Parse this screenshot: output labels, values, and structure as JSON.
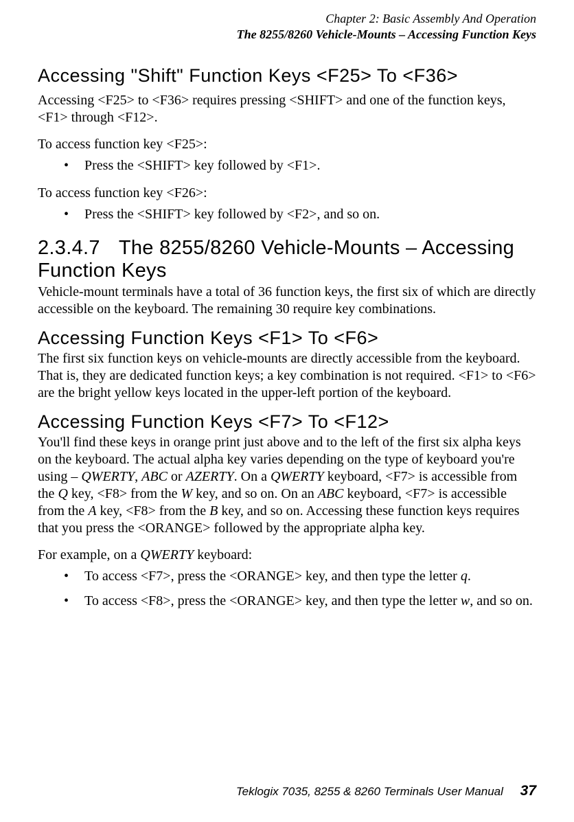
{
  "header": {
    "chapter_line": "Chapter 2: Basic Assembly And Operation",
    "section_line": "The 8255/8260 Vehicle-Mounts – Accessing Function Keys"
  },
  "s1": {
    "heading": "Accessing \"Shift\" Function Keys <F25> To <F36>",
    "p1": "Accessing <F25> to <F36> requires pressing <SHIFT> and one of the function keys, <F1> through <F12>.",
    "lead1": "To access function key <F25>:",
    "b1": "Press the <SHIFT> key followed by <F1>.",
    "lead2": "To access function key <F26>:",
    "b2": "Press the <SHIFT> key followed by <F2>, and so on."
  },
  "s2": {
    "num": "2.3.4.7",
    "title": "The 8255/8260 Vehicle-Mounts – Accessing Function Keys",
    "p1": "Vehicle-mount terminals have a total of 36 function keys, the first six of which are directly accessible on the keyboard. The remaining 30 require key combinations."
  },
  "s3": {
    "heading": "Accessing Function Keys <F1> To <F6>",
    "p1": "The first six function keys on vehicle-mounts are directly accessible from the keyboard. That is, they are dedicated function keys; a key combination is not required. <F1> to <F6> are the bright yellow keys located in the upper-left portion of the keyboard."
  },
  "s4": {
    "heading": "Accessing Function Keys <F7> To <F12>",
    "p1_a": "You'll find these keys in orange print just above and to the left of the first six alpha keys on the keyboard. The actual alpha key varies depending on the type of keyboard you're using – ",
    "p1_b": "QWERTY",
    "p1_c": ", ",
    "p1_d": "ABC",
    "p1_e": " or ",
    "p1_f": "AZERTY",
    "p1_g": ". On a ",
    "p1_h": "QWERTY",
    "p1_i": " keyboard, <F7> is accessible from the ",
    "p1_j": "Q",
    "p1_k": " key, <F8> from the ",
    "p1_l": "W",
    "p1_m": " key, and so on. On an ",
    "p1_n": "ABC",
    "p1_o": " keyboard, <F7> is accessible from the ",
    "p1_p": "A",
    "p1_q": " key, <F8> from the ",
    "p1_r": "B",
    "p1_s": " key, and so on. Accessing these function keys requires that you press the <ORANGE> followed by the appropriate alpha key.",
    "lead_a": "For example, on a ",
    "lead_b": "QWERTY",
    "lead_c": " keyboard:",
    "b1_a": "To access <F7>, press the <ORANGE> key, and then type the letter ",
    "b1_b": "q",
    "b1_c": ".",
    "b2_a": "To access <F8>, press the <ORANGE> key, and then type the letter ",
    "b2_b": "w",
    "b2_c": ", and so on."
  },
  "footer": {
    "title": "Teklogix 7035, 8255 & 8260 Terminals User Manual",
    "page": "37"
  }
}
